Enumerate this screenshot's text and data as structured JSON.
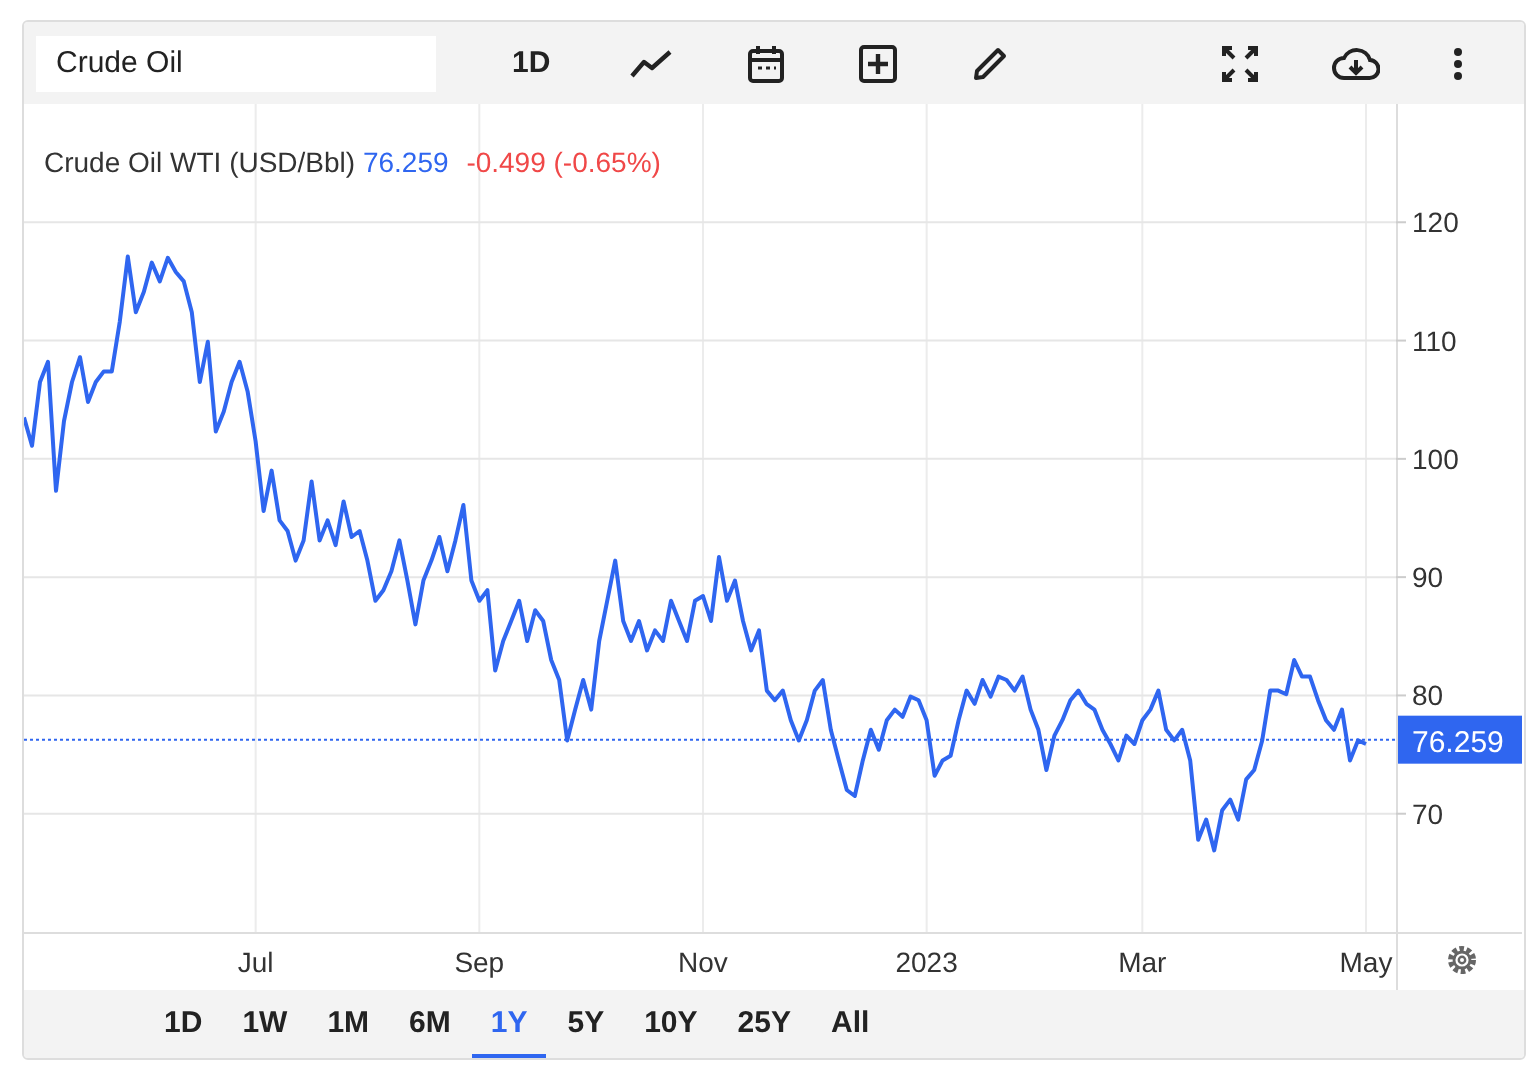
{
  "toolbar": {
    "search": {
      "value": "Crude Oil"
    },
    "interval": "1D"
  },
  "legend": {
    "price": "76.259",
    "change": "-0.499 (-0.65%)"
  },
  "chart": {
    "price_tag": "76.259",
    "chart_data": {
      "type": "line",
      "grid": true,
      "ylim": [
        60,
        130
      ],
      "categories": [
        null,
        null,
        null,
        null,
        null,
        null,
        null,
        null,
        null,
        null,
        null,
        null,
        null,
        null,
        null,
        null,
        null,
        null,
        null,
        null,
        null,
        null,
        null,
        null,
        null,
        null,
        null,
        null,
        null,
        "Jul",
        null,
        null,
        null,
        null,
        null,
        null,
        null,
        null,
        null,
        null,
        null,
        null,
        null,
        null,
        null,
        null,
        null,
        null,
        null,
        null,
        null,
        null,
        null,
        null,
        null,
        null,
        null,
        "Sep",
        null,
        null,
        null,
        null,
        null,
        null,
        null,
        null,
        null,
        null,
        null,
        null,
        null,
        null,
        null,
        null,
        null,
        null,
        null,
        null,
        null,
        null,
        null,
        null,
        null,
        null,
        null,
        "Nov",
        null,
        null,
        null,
        null,
        null,
        null,
        null,
        null,
        null,
        null,
        null,
        null,
        null,
        null,
        null,
        null,
        null,
        null,
        null,
        null,
        null,
        null,
        null,
        null,
        null,
        null,
        null,
        "2023",
        null,
        null,
        null,
        null,
        null,
        null,
        null,
        null,
        null,
        null,
        null,
        null,
        null,
        null,
        null,
        null,
        null,
        null,
        null,
        null,
        null,
        null,
        null,
        null,
        null,
        null,
        "Mar",
        null,
        null,
        null,
        null,
        null,
        null,
        null,
        null,
        null,
        null,
        null,
        null,
        null,
        null,
        null,
        null,
        null,
        null,
        null,
        null,
        null,
        null,
        null,
        null,
        null,
        null,
        null,
        "May"
      ],
      "ref_lines": [
        {
          "axis": "y",
          "value": 76.259,
          "color": "#2f66f0"
        }
      ],
      "yticks": [
        70,
        80,
        90,
        100,
        110,
        120
      ],
      "series": [
        {
          "name": "Crude Oil WTI (USD/Bbl)",
          "color": "#2f66f0",
          "values": [
            103.5,
            101.1,
            106.5,
            108.2,
            97.3,
            103.2,
            106.5,
            108.6,
            104.8,
            106.5,
            107.4,
            107.4,
            111.6,
            117.1,
            112.4,
            114.1,
            116.6,
            115.0,
            117.0,
            115.8,
            115.0,
            112.4,
            106.5,
            109.9,
            102.3,
            104.0,
            106.5,
            108.2,
            105.7,
            101.5,
            95.6,
            99.0,
            94.8,
            93.9,
            91.4,
            93.1,
            98.1,
            93.1,
            94.8,
            92.7,
            96.4,
            93.4,
            93.9,
            91.4,
            88.0,
            88.9,
            90.5,
            93.1,
            89.7,
            86.0,
            89.7,
            91.4,
            93.4,
            90.5,
            93.1,
            96.1,
            89.7,
            88.0,
            88.9,
            82.1,
            84.6,
            86.3,
            88.0,
            84.6,
            87.2,
            86.3,
            83.0,
            81.3,
            76.2,
            78.8,
            81.3,
            78.8,
            84.6,
            88.0,
            91.4,
            86.3,
            84.6,
            86.3,
            83.8,
            85.5,
            84.6,
            88.0,
            86.3,
            84.6,
            88.0,
            88.4,
            86.3,
            91.7,
            88.0,
            89.7,
            86.3,
            83.8,
            85.5,
            80.4,
            79.6,
            80.4,
            77.9,
            76.2,
            77.9,
            80.4,
            81.3,
            77.1,
            74.5,
            72.0,
            71.5,
            74.5,
            77.1,
            75.4,
            77.9,
            78.8,
            78.2,
            79.9,
            79.6,
            77.9,
            73.2,
            74.5,
            74.9,
            77.9,
            80.4,
            79.3,
            81.3,
            79.9,
            81.6,
            81.3,
            80.4,
            81.6,
            78.8,
            77.1,
            73.7,
            76.6,
            77.9,
            79.6,
            80.4,
            79.3,
            78.8,
            77.1,
            75.9,
            74.5,
            76.6,
            75.9,
            77.9,
            78.8,
            80.4,
            77.1,
            76.2,
            77.1,
            74.5,
            67.8,
            69.5,
            66.9,
            70.3,
            71.2,
            69.5,
            72.9,
            73.7,
            76.2,
            80.4,
            80.4,
            80.1,
            83.0,
            81.6,
            81.6,
            79.6,
            77.9,
            77.1,
            78.8,
            74.5,
            76.2,
            75.9
          ]
        }
      ]
    }
  },
  "ranges": [
    {
      "label": "1D",
      "selected": false
    },
    {
      "label": "1W",
      "selected": false
    },
    {
      "label": "1M",
      "selected": false
    },
    {
      "label": "6M",
      "selected": false
    },
    {
      "label": "1Y",
      "selected": true
    },
    {
      "label": "5Y",
      "selected": false
    },
    {
      "label": "10Y",
      "selected": false
    },
    {
      "label": "25Y",
      "selected": false
    },
    {
      "label": "All",
      "selected": false
    }
  ]
}
